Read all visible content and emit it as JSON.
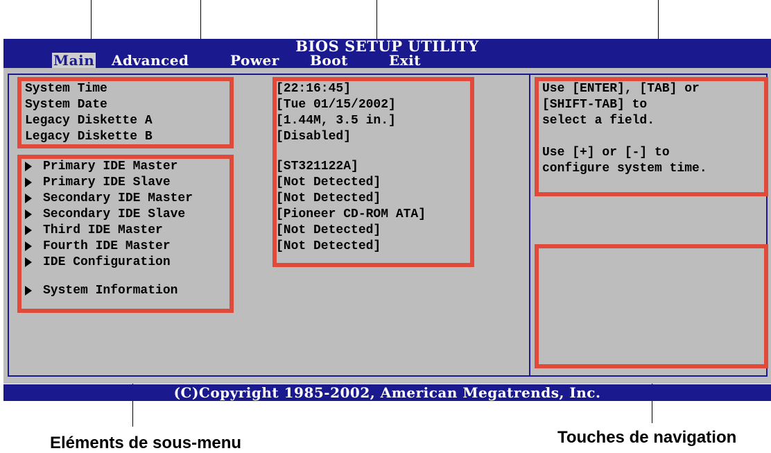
{
  "title": "BIOS SETUP UTILITY",
  "menu_tabs": [
    {
      "label": "Main",
      "active": true
    },
    {
      "label": "Advanced",
      "active": false
    },
    {
      "label": "Power",
      "active": false
    },
    {
      "label": "Boot",
      "active": false
    },
    {
      "label": "Exit",
      "active": false
    }
  ],
  "settings": [
    {
      "label": "System Time",
      "value": "[22:16:45]"
    },
    {
      "label": "System Date",
      "value": "[Tue 01/15/2002]"
    },
    {
      "label": "Legacy Diskette A",
      "value": "[1.44M, 3.5 in.]"
    },
    {
      "label": "Legacy Diskette B",
      "value": "[Disabled]"
    }
  ],
  "submenu_items": [
    {
      "label": "Primary IDE Master",
      "value": "[ST321122A]"
    },
    {
      "label": "Primary IDE Slave",
      "value": "[Not Detected]"
    },
    {
      "label": "Secondary IDE Master",
      "value": "[Not Detected]"
    },
    {
      "label": "Secondary IDE Slave",
      "value": "[Pioneer CD-ROM ATA]"
    },
    {
      "label": "Third IDE Master",
      "value": "[Not Detected]"
    },
    {
      "label": "Fourth IDE Master",
      "value": "[Not Detected]"
    },
    {
      "label": "IDE Configuration",
      "value": ""
    },
    {
      "label": "System Information",
      "value": ""
    }
  ],
  "help_text": [
    "Use [ENTER], [TAB] or",
    "[SHIFT-TAB] to",
    "select a field.",
    "",
    "Use [+] or [-] to",
    "configure system time."
  ],
  "copyright": "(C)Copyright 1985-2002, American Megatrends, Inc.",
  "captions": {
    "submenu": "Eléments de sous-menu",
    "navigation": "Touches de navigation"
  },
  "colors": {
    "bios_blue": "#1a1a8e",
    "panel_gray": "#bdbdbd",
    "annotation_red": "#e04a3a"
  }
}
